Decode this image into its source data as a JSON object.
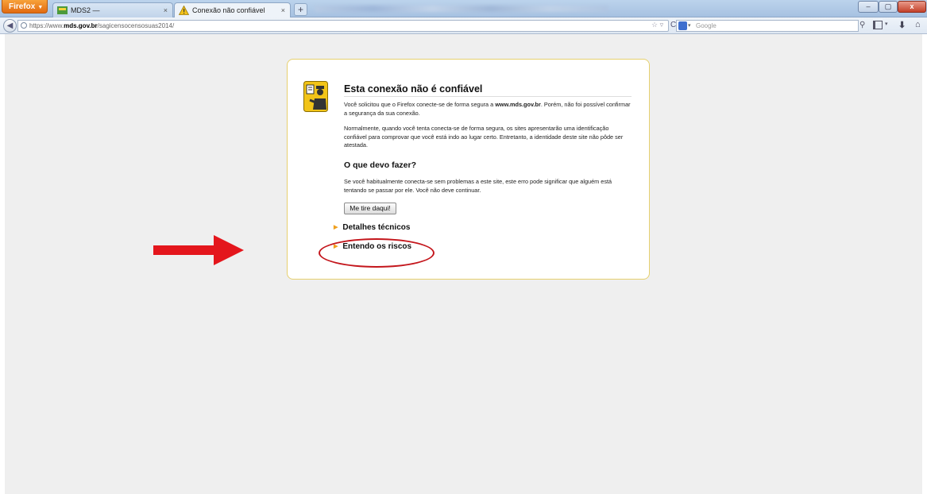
{
  "browser": {
    "menu_label": "Firefox",
    "tabs": [
      {
        "label": "MDS2 —",
        "active": false
      },
      {
        "label": "Conexão não confiável",
        "active": true
      }
    ],
    "new_tab_symbol": "+",
    "window_buttons": {
      "minimize": "–",
      "maximize": "▢",
      "close": "x"
    }
  },
  "navigation": {
    "url_prefix": "https://www.",
    "url_host": "mds.gov.br",
    "url_path": "/sagicensocensosuas2014/",
    "search_placeholder": "Google",
    "icons": [
      "back-arrow-icon",
      "globe-icon",
      "star-icon",
      "reload-icon",
      "search-icon",
      "bookmarks-icon",
      "download-icon",
      "home-icon"
    ]
  },
  "error_page": {
    "title": "Esta conexão não é confiável",
    "para1_before": "Você solicitou que o Firefox conecte-se de forma segura a ",
    "para1_host": "www.mds.gov.br",
    "para1_after": ". Porém, não foi possível confirmar a segurança da sua conexão.",
    "para2": "Normalmente, quando você tenta conecta-se de forma segura, os sites apresentarão uma identificação confiável para comprovar que você está indo ao lugar certo. Entretanto, a identidade deste site não pôde ser atestada.",
    "what_heading": "O que devo fazer?",
    "para3": "Se você habitualmente conecta-se sem problemas a este site, este erro pode significar que alguém está tentando se passar por ele. Você não deve continuar.",
    "get_out_button": "Me tire daqui!",
    "technical_details": "Detalhes técnicos",
    "understand_risks": "Entendo os riscos"
  },
  "annotation": {
    "arrow_color": "#e4161c",
    "circle_color": "#c4161c"
  }
}
